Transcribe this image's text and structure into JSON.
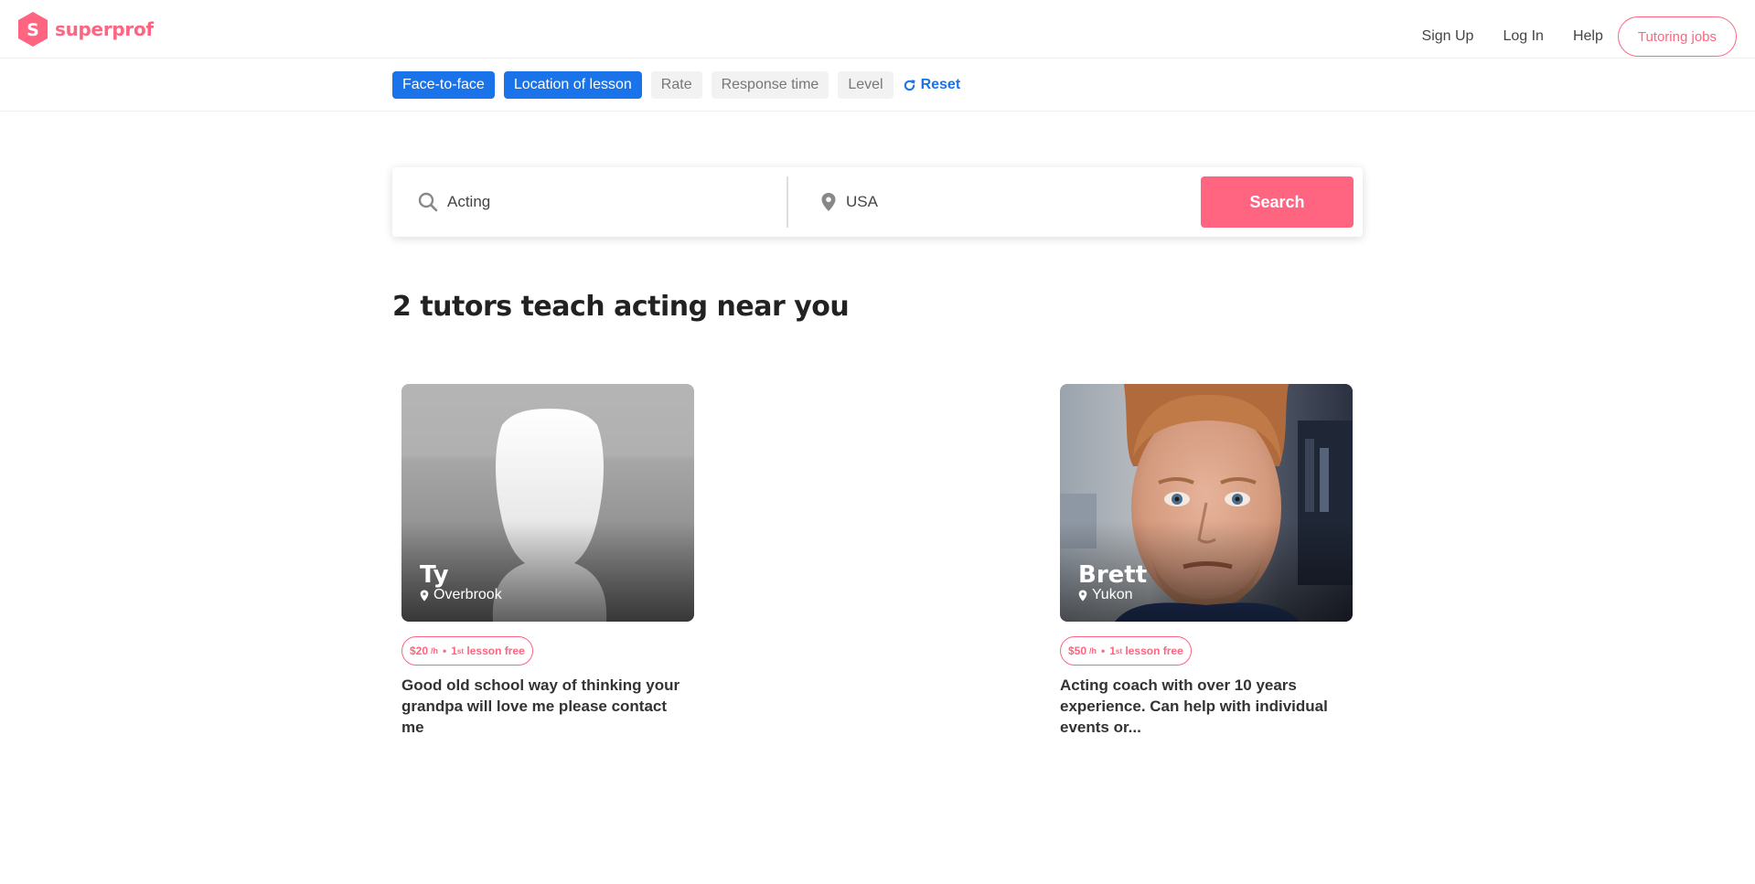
{
  "header": {
    "logo_text": "superprof",
    "nav": {
      "signup": "Sign Up",
      "login": "Log In",
      "help": "Help",
      "jobs": "Tutoring jobs"
    }
  },
  "filters": {
    "chips": [
      {
        "label": "Face-to-face",
        "active": true
      },
      {
        "label": "Location of lesson",
        "active": true
      },
      {
        "label": "Rate",
        "active": false
      },
      {
        "label": "Response time",
        "active": false
      },
      {
        "label": "Level",
        "active": false
      }
    ],
    "reset": "Reset"
  },
  "search": {
    "subject_value": "Acting",
    "location_value": "USA",
    "button": "Search"
  },
  "results_heading": "2 tutors teach acting near you",
  "tutors": [
    {
      "name": "Ty",
      "location": "Overbrook",
      "price": "$20",
      "unit": "/h",
      "first_lesson_prefix": "1",
      "first_lesson_sup": "st",
      "first_lesson_suffix": " lesson free",
      "description": "Good old school way of thinking your grandpa will love me please contact me",
      "photo": "default-avatar-silhouette"
    },
    {
      "name": "Brett",
      "location": "Yukon",
      "price": "$50",
      "unit": "/h",
      "first_lesson_prefix": "1",
      "first_lesson_sup": "st",
      "first_lesson_suffix": " lesson free",
      "description": "Acting coach with over 10 years experience. Can help with individual events or...",
      "photo": "tutor-portrait"
    }
  ],
  "colors": {
    "brand": "#ff6480",
    "accent": "#1a73e8"
  }
}
